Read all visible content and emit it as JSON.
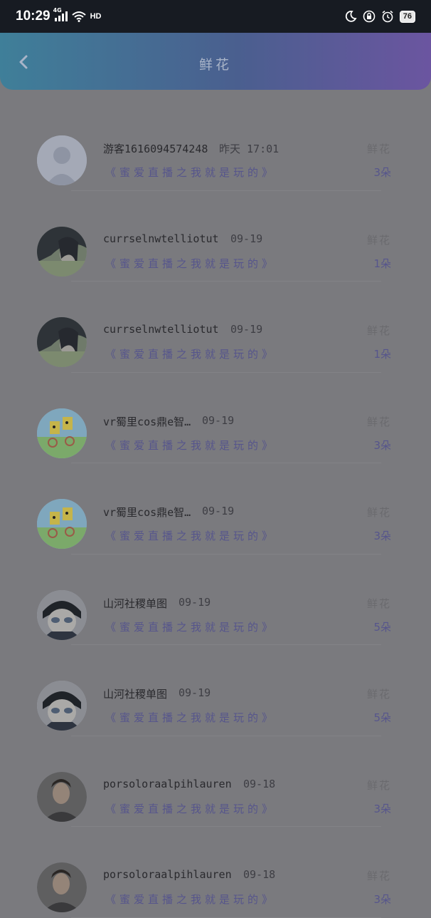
{
  "status": {
    "time": "10:29",
    "network": "4G",
    "hd": "HD",
    "battery": "76"
  },
  "header": {
    "title": "鲜花"
  },
  "items": [
    {
      "name": "游客1616094574248",
      "date": "昨天 17:01",
      "subtitle": "《蜜爱直播之我就是玩的》",
      "gift": "鲜花",
      "count": "3朵",
      "avatar": "default"
    },
    {
      "name": "currselnwtelliotut",
      "date": "09-19",
      "subtitle": "《蜜爱直播之我就是玩的》",
      "gift": "鲜花",
      "count": "1朵",
      "avatar": "girl"
    },
    {
      "name": "currselnwtelliotut",
      "date": "09-19",
      "subtitle": "《蜜爱直播之我就是玩的》",
      "gift": "鲜花",
      "count": "1朵",
      "avatar": "girl"
    },
    {
      "name": "vr蜀里cos鼎e智…",
      "date": "09-19",
      "subtitle": "《蜜爱直播之我就是玩的》",
      "gift": "鲜花",
      "count": "3朵",
      "avatar": "cartoon"
    },
    {
      "name": "vr蜀里cos鼎e智…",
      "date": "09-19",
      "subtitle": "《蜜爱直播之我就是玩的》",
      "gift": "鲜花",
      "count": "3朵",
      "avatar": "cartoon"
    },
    {
      "name": "山河社稷单图",
      "date": "09-19",
      "subtitle": "《蜜爱直播之我就是玩的》",
      "gift": "鲜花",
      "count": "5朵",
      "avatar": "anime"
    },
    {
      "name": "山河社稷单图",
      "date": "09-19",
      "subtitle": "《蜜爱直播之我就是玩的》",
      "gift": "鲜花",
      "count": "5朵",
      "avatar": "anime"
    },
    {
      "name": "porsoloraalpihlauren",
      "date": "09-18",
      "subtitle": "《蜜爱直播之我就是玩的》",
      "gift": "鲜花",
      "count": "3朵",
      "avatar": "man"
    },
    {
      "name": "porsoloraalpihlauren",
      "date": "09-18",
      "subtitle": "《蜜爱直播之我就是玩的》",
      "gift": "鲜花",
      "count": "3朵",
      "avatar": "man"
    }
  ]
}
